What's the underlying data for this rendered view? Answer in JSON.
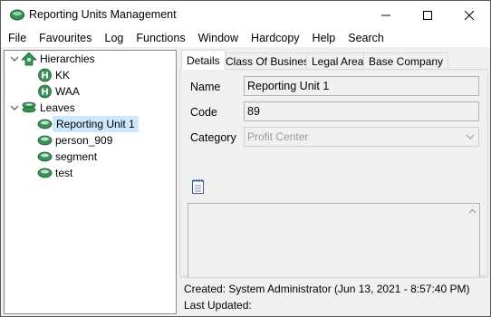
{
  "window": {
    "title": "Reporting Units Management",
    "controls": {
      "minimize": "minimize",
      "maximize": "maximize",
      "close": "close"
    }
  },
  "menu": {
    "items": [
      "File",
      "Favourites",
      "Log",
      "Functions",
      "Window",
      "Hardcopy",
      "Help",
      "Search"
    ]
  },
  "tree": {
    "groups": [
      {
        "label": "Hierarchies",
        "icon": "hierarchies-icon",
        "expanded": true,
        "children": [
          {
            "label": "KK",
            "icon": "hierarchy-h-icon"
          },
          {
            "label": "WAA",
            "icon": "hierarchy-h-icon"
          }
        ]
      },
      {
        "label": "Leaves",
        "icon": "leaves-icon",
        "expanded": true,
        "children": [
          {
            "label": "Reporting Unit 1",
            "icon": "reporting-unit-icon",
            "selected": true
          },
          {
            "label": "person_909",
            "icon": "reporting-unit-icon"
          },
          {
            "label": "segment",
            "icon": "reporting-unit-icon"
          },
          {
            "label": "test",
            "icon": "reporting-unit-icon"
          }
        ]
      }
    ]
  },
  "tabs": [
    "Details",
    "Class Of Business",
    "Legal Area",
    "Base Company"
  ],
  "details": {
    "name_label": "Name",
    "name_value": "Reporting Unit 1",
    "code_label": "Code",
    "code_value": "89",
    "category_label": "Category",
    "category_value": "Profit Center"
  },
  "audit": {
    "created": "Created: System Administrator (Jun 13, 2021 - 8:57:40 PM)",
    "last_updated": "Last Updated:"
  },
  "colors": {
    "selection": "#cce8ff",
    "icon_green": "#3c8f5a",
    "border": "#828790"
  }
}
